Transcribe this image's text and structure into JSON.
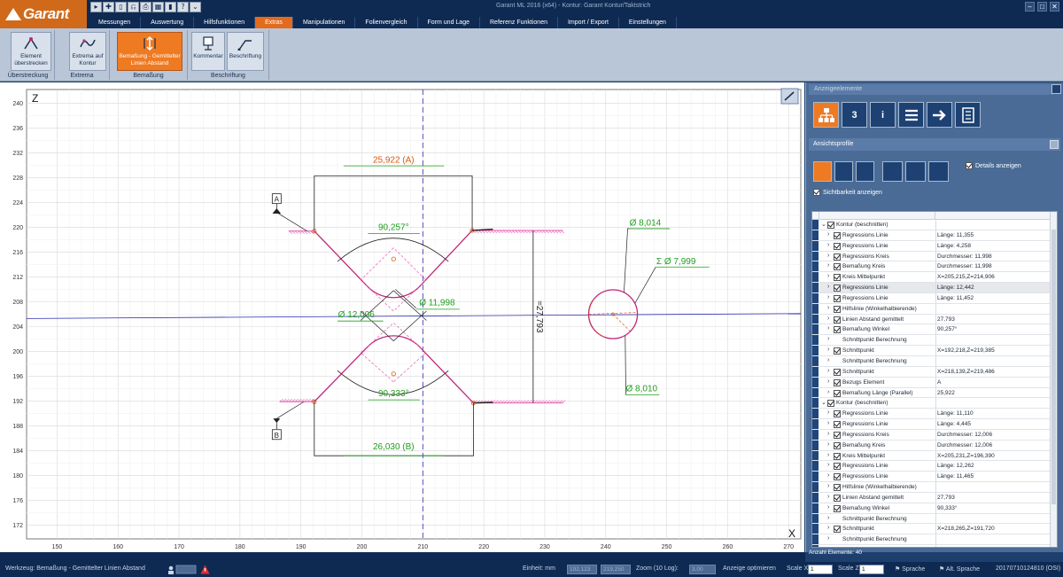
{
  "app": {
    "logo": "Garant",
    "window_title": "Garant ML 2016 (x64) - Kontur: Garant Kontur/Taktstrich",
    "window_controls": [
      "–",
      "□",
      "✕"
    ]
  },
  "quick_access": [
    "▸",
    "✚",
    "▯",
    "⎌",
    "⎙",
    "▦",
    "▮",
    "?",
    "⌄"
  ],
  "menu": [
    "Messungen",
    "Auswertung",
    "Hilfsfunktionen",
    "Extras",
    "Manipulationen",
    "Folienvergleich",
    "Form und Lage",
    "Referenz Funktionen",
    "Import / Export",
    "Einstellungen"
  ],
  "menu_active": "Extras",
  "ribbon": {
    "groups": [
      {
        "label": "Überstreckung",
        "buttons": [
          {
            "label": "Element überstrecken"
          }
        ]
      },
      {
        "label": "Extrema",
        "buttons": [
          {
            "label": "Extrema auf Kontur"
          }
        ]
      },
      {
        "label": "Bemaßung",
        "buttons": [
          {
            "label": "Bemaßung - Gemittelter Linien Abstand"
          }
        ]
      },
      {
        "label": "Beschriftung",
        "buttons": [
          {
            "label": "Kommentar"
          },
          {
            "label": "Beschriftung"
          }
        ]
      }
    ]
  },
  "canvas": {
    "axis_z": "Z",
    "axis_x": "X",
    "y_ticks": [
      "240",
      "236",
      "232",
      "228",
      "224",
      "220",
      "216",
      "212",
      "208",
      "204",
      "200",
      "196",
      "192",
      "188",
      "184",
      "180",
      "176",
      "172"
    ],
    "x_ticks": [
      "150",
      "160",
      "170",
      "180",
      "190",
      "200",
      "210",
      "220",
      "230",
      "240",
      "250",
      "260",
      "270"
    ],
    "labels": {
      "dim_top": "25,922 (A)",
      "dim_bottom": "26,030 (B)",
      "angle_top": "90,257°",
      "angle_bottom": "90,333°",
      "dia_small_top": "Ø 11,998",
      "dia_small_bottom": "Ø 12,006",
      "dist_vertical": "=27,793",
      "circle_top": "Ø 8,014",
      "circle_mid": "Σ Ø 7,999",
      "circle_bottom": "Ø 8,010",
      "ref_a": "A",
      "ref_b": "B"
    },
    "colors": {
      "contour": "#c0267a",
      "hatch": "#e85ab4",
      "dim": "#1a1a1a",
      "green": "#1fa01f",
      "orange": "#e0570a",
      "axis_blue": "#2a2ab0"
    }
  },
  "panel": {
    "title": "Anzeigeelemente",
    "tools": [
      "3",
      "i"
    ],
    "profiles_label": "Ansichtsprofile",
    "details_label": "Details anzeigen",
    "sichtbarkeit_label": "Sichtbarkeit anzeigen",
    "footer": "Anzahl Elemente: 40",
    "rows": [
      {
        "level": 0,
        "name": "Kontur (beschnitten)",
        "value": "",
        "chk": true,
        "open": true
      },
      {
        "level": 1,
        "name": "Regressions Linie",
        "value": "Länge: 11,355",
        "chk": true
      },
      {
        "level": 1,
        "name": "Regressions Linie",
        "value": "Länge: 4,258",
        "chk": true
      },
      {
        "level": 1,
        "name": "Regressions Kreis",
        "value": "Durchmesser: 11,998",
        "chk": true
      },
      {
        "level": 1,
        "name": "Bemaßung Kreis",
        "value": "Durchmesser: 11,998",
        "chk": true
      },
      {
        "level": 1,
        "name": "Kreis Mittelpunkt",
        "value": "X=205,215,Z=214,906",
        "chk": true
      },
      {
        "level": 1,
        "name": "Regressions Linie",
        "value": "Länge: 12,442",
        "chk": true,
        "sel": true
      },
      {
        "level": 1,
        "name": "Regressions Linie",
        "value": "Länge: 11,452",
        "chk": true
      },
      {
        "level": 1,
        "name": "Hilfslinie (Winkelhalbierende)",
        "value": "",
        "chk": true
      },
      {
        "level": 1,
        "name": "Linien Abstand gemittelt",
        "value": "27,793",
        "chk": true
      },
      {
        "level": 1,
        "name": "Bemaßung Winkel",
        "value": "90,257°",
        "chk": true
      },
      {
        "level": 1,
        "name": "Schnittpunkt Berechnung",
        "value": "",
        "chk": false
      },
      {
        "level": 1,
        "name": "Schnittpunkt",
        "value": "X=192,218,Z=219,385",
        "chk": true
      },
      {
        "level": 1,
        "name": "Schnittpunkt Berechnung",
        "value": "",
        "chk": false
      },
      {
        "level": 1,
        "name": "Schnittpunkt",
        "value": "X=218,139,Z=219,486",
        "chk": true
      },
      {
        "level": 1,
        "name": "Bezugs Element",
        "value": "A",
        "chk": true
      },
      {
        "level": 1,
        "name": "Bemaßung Länge (Parallel)",
        "value": "25,922",
        "chk": true
      },
      {
        "level": 0,
        "name": "Kontur (beschnitten)",
        "value": "",
        "chk": true,
        "open": true
      },
      {
        "level": 1,
        "name": "Regressions Linie",
        "value": "Länge: 11,110",
        "chk": true
      },
      {
        "level": 1,
        "name": "Regressions Linie",
        "value": "Länge: 4,445",
        "chk": true
      },
      {
        "level": 1,
        "name": "Regressions Kreis",
        "value": "Durchmesser: 12,006",
        "chk": true
      },
      {
        "level": 1,
        "name": "Bemaßung Kreis",
        "value": "Durchmesser: 12,006",
        "chk": true
      },
      {
        "level": 1,
        "name": "Kreis Mittelpunkt",
        "value": "X=205,231,Z=196,390",
        "chk": true
      },
      {
        "level": 1,
        "name": "Regressions Linie",
        "value": "Länge: 12,262",
        "chk": true
      },
      {
        "level": 1,
        "name": "Regressions Linie",
        "value": "Länge: 11,465",
        "chk": true
      },
      {
        "level": 1,
        "name": "Hilfslinie (Winkelhalbierende)",
        "value": "",
        "chk": true
      },
      {
        "level": 1,
        "name": "Linien Abstand gemittelt",
        "value": "27,793",
        "chk": true
      },
      {
        "level": 1,
        "name": "Bemaßung Winkel",
        "value": "90,333°",
        "chk": true
      },
      {
        "level": 1,
        "name": "Schnittpunkt Berechnung",
        "value": "",
        "chk": false
      },
      {
        "level": 1,
        "name": "Schnittpunkt",
        "value": "X=218,265,Z=191,720",
        "chk": true
      },
      {
        "level": 1,
        "name": "Schnittpunkt Berechnung",
        "value": "",
        "chk": false
      },
      {
        "level": 1,
        "name": "Schnittpunkt",
        "value": "X=192,234,Z=191,893",
        "chk": true
      }
    ]
  },
  "status": {
    "tool": "Werkzeug: Bemaßung - Gemittelter Linien Abstand",
    "einheit_label": "Einheit: mm",
    "coord_x": "192,123",
    "coord_z": "219,250",
    "zoom_label": "Zoom (10 Log):",
    "zoom_value": "3,00",
    "anzeige": "Anzeige optimieren",
    "scale_x_label": "Scale X",
    "scale_x": "1",
    "scale_z_label": "Scale Z",
    "scale_z": "1",
    "sprache": "Sprache",
    "alt_sprache": "Alt. Sprache",
    "build": "20170710124810 (OSI)"
  }
}
